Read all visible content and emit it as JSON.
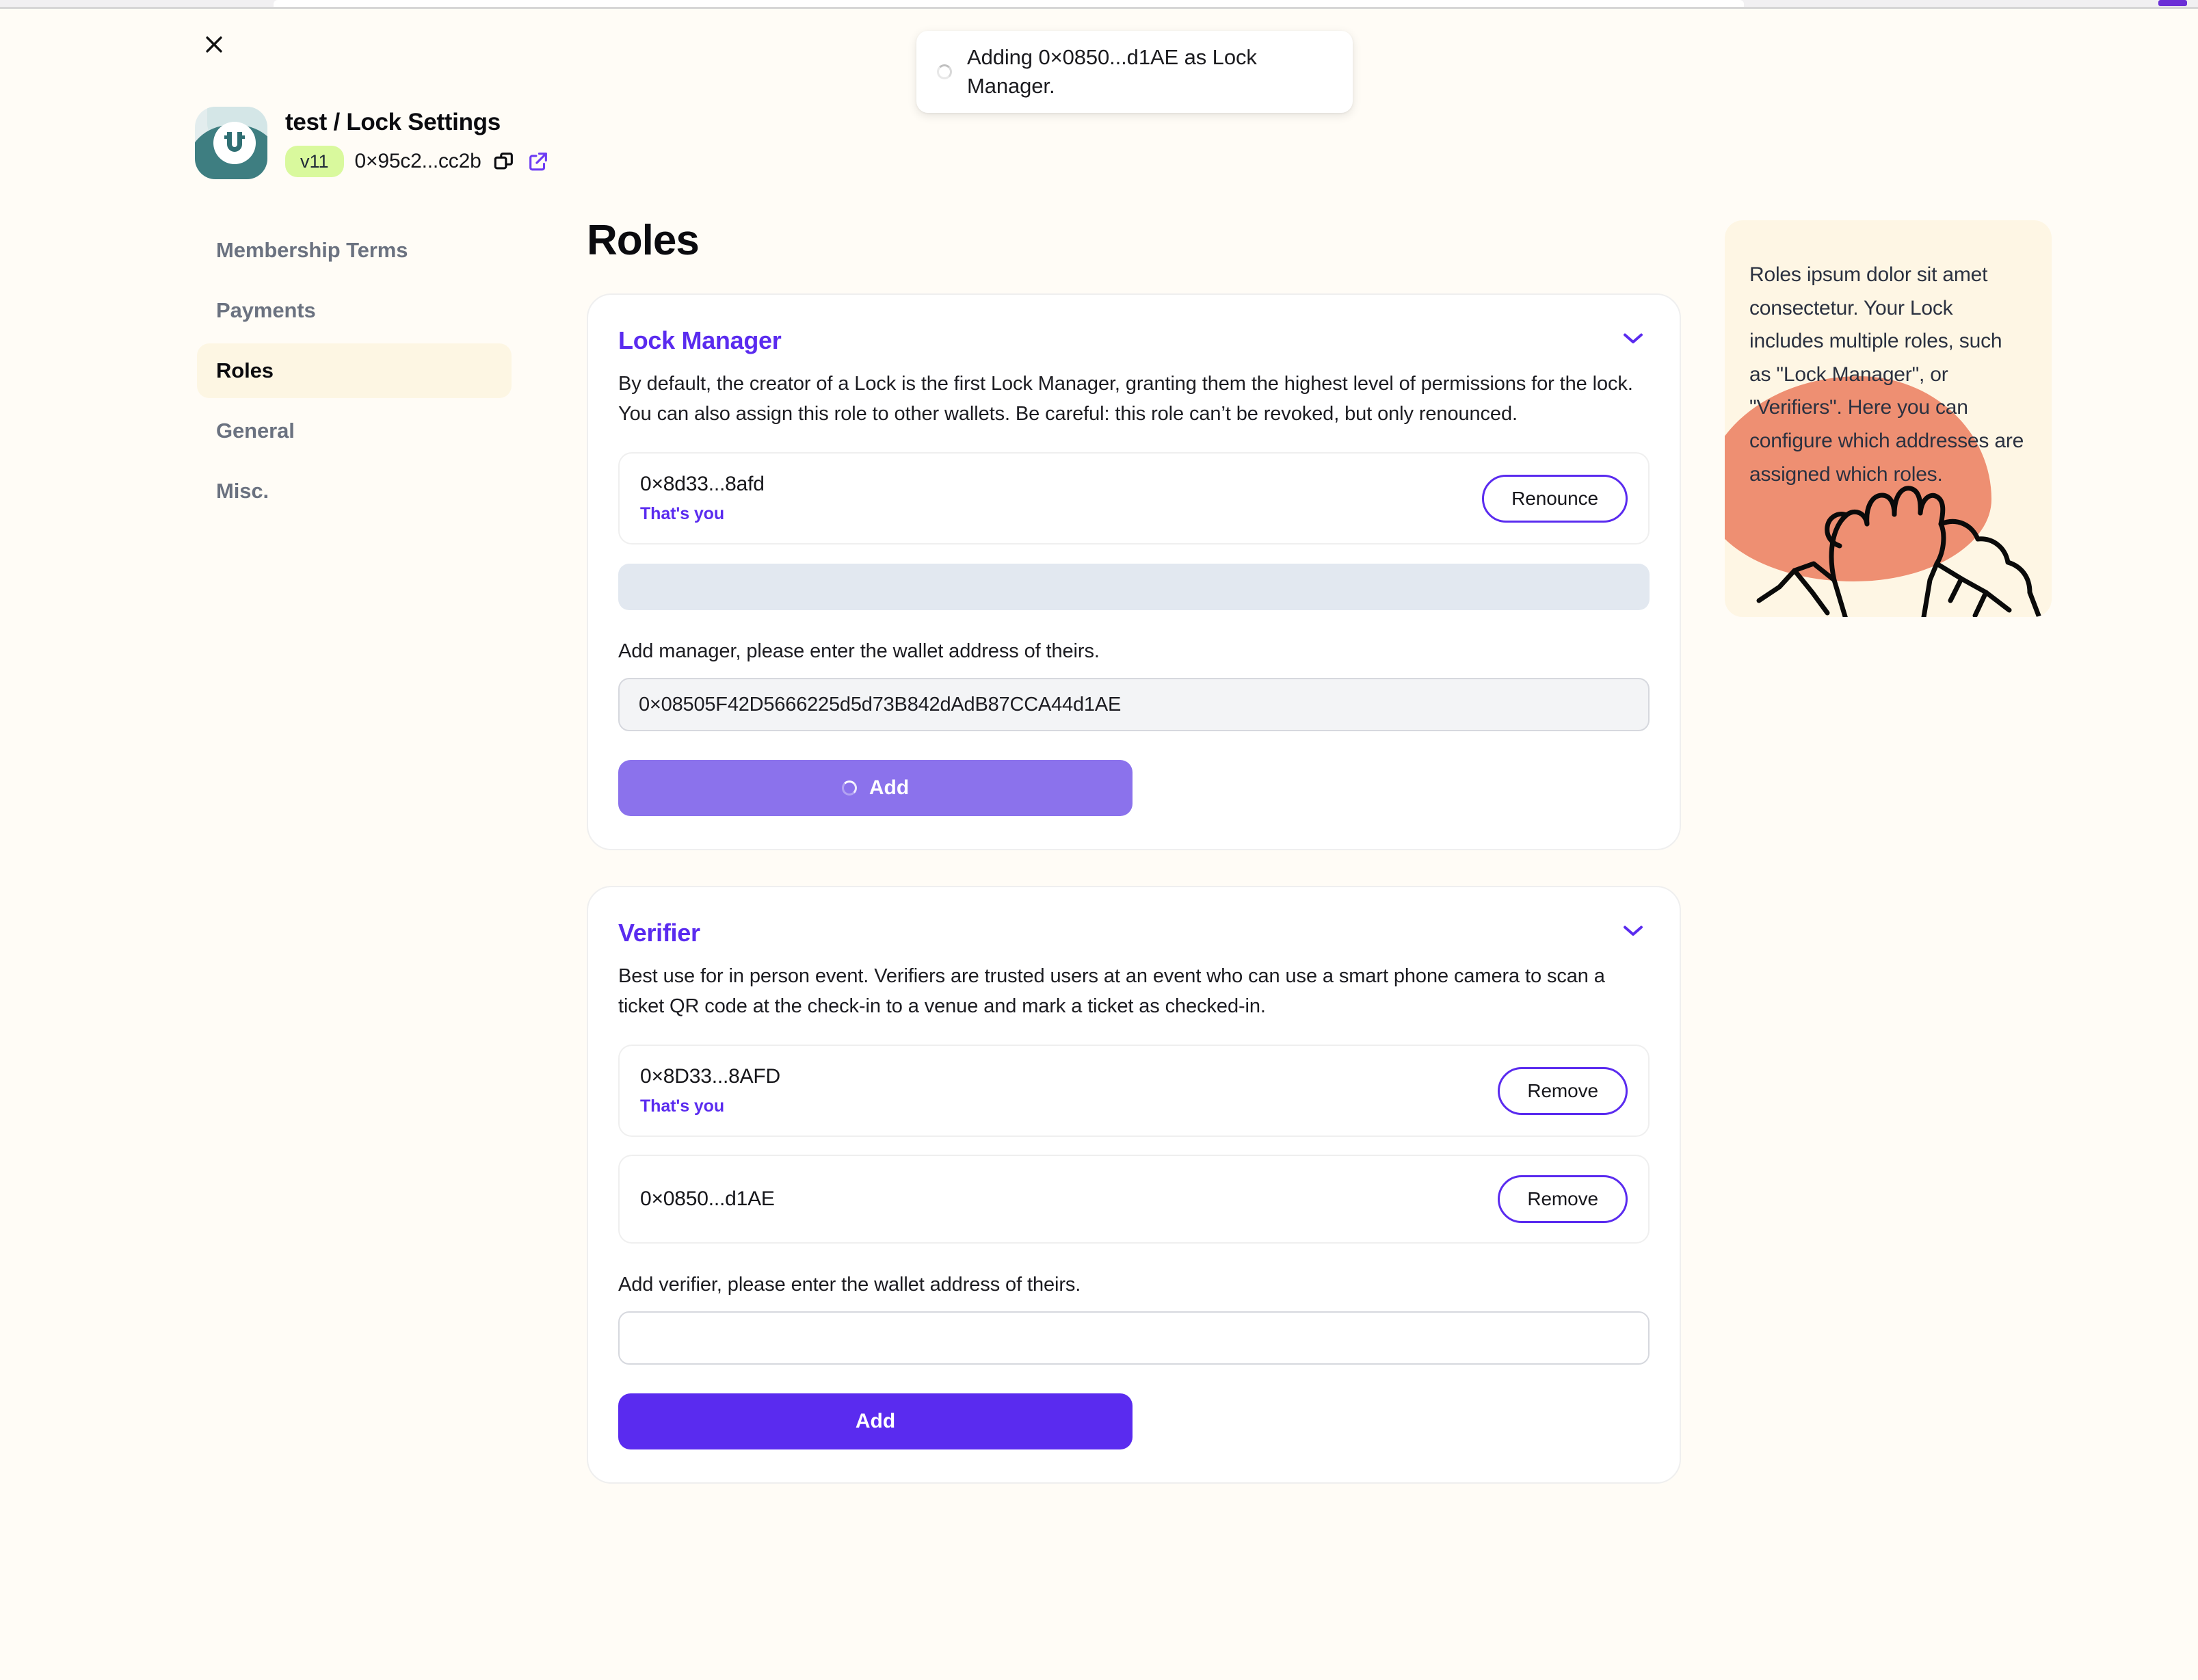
{
  "toast": {
    "message": "Adding 0×0850...d1AE as Lock Manager.",
    "spinner": "loading-spinner-icon"
  },
  "header": {
    "close_icon": "close-icon",
    "avatar": "lock-avatar-logo",
    "title": "test / Lock Settings",
    "version_badge": "v11",
    "address": "0×95c2...cc2b",
    "copy_icon": "copy-icon",
    "external_link_icon": "external-link-icon"
  },
  "sidebar": {
    "items": [
      {
        "label": "Membership Terms",
        "active": false
      },
      {
        "label": "Payments",
        "active": false
      },
      {
        "label": "Roles",
        "active": true
      },
      {
        "label": "General",
        "active": false
      },
      {
        "label": "Misc.",
        "active": false
      }
    ]
  },
  "main": {
    "page_title": "Roles",
    "lock_manager": {
      "title": "Lock Manager",
      "chevron_icon": "chevron-down-icon",
      "description": "By default, the creator of a Lock is the first Lock Manager, granting them the highest level of permissions for the lock. You can also assign this role to other wallets. Be careful: this role can’t be revoked, but only renounced.",
      "members": [
        {
          "address": "0×8d33...8afd",
          "you_label": "That's you",
          "action_label": "Renounce"
        }
      ],
      "skeleton_loading": true,
      "field_label": "Add manager, please enter the wallet address of theirs.",
      "input_value": "0×08505F42D5666225d5d73B842dAdB87CCA44d1AE",
      "input_placeholder": "",
      "add_label": "Add",
      "add_loading": true
    },
    "verifier": {
      "title": "Verifier",
      "chevron_icon": "chevron-down-icon",
      "description": "Best use for in person event. Verifiers are trusted users at an event who can use a smart phone camera to scan a ticket QR code at the check-in to a venue and mark a ticket as checked-in.",
      "members": [
        {
          "address": "0×8D33...8AFD",
          "you_label": "That's you",
          "action_label": "Remove"
        },
        {
          "address": "0×0850...d1AE",
          "you_label": "",
          "action_label": "Remove"
        }
      ],
      "field_label": "Add verifier, please enter the wallet address of theirs.",
      "input_value": "",
      "input_placeholder": "",
      "add_label": "Add",
      "add_loading": false
    }
  },
  "info_panel": {
    "text": "Roles ipsum dolor sit amet consectetur. Your Lock includes multiple roles, such as \"Lock Manager\", or \"Verifiers\". Here you can configure which addresses are assigned which roles.",
    "illustration": "high-five-hands-illustration"
  },
  "colors": {
    "accent_purple": "#5A2BEF",
    "page_background": "#FFFCF6",
    "badge_green": "#D9F99D",
    "info_panel_bg": "#FEF6E4",
    "info_blob": "#EE8F72",
    "skeleton": "#E2E8F0"
  }
}
